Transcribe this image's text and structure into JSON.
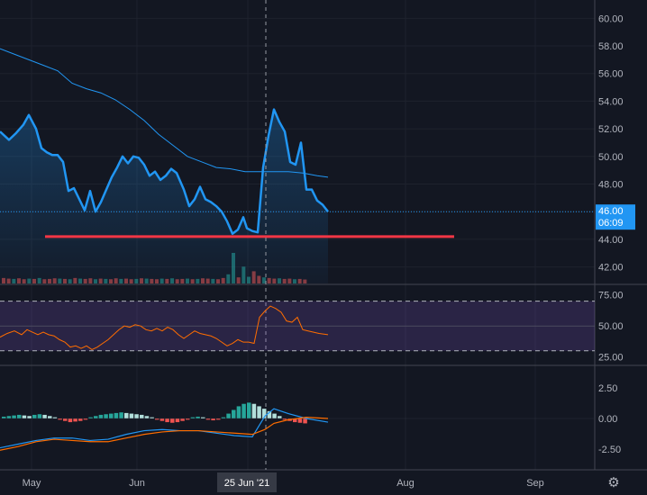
{
  "chart_data": [
    {
      "type": "line",
      "panel": "price",
      "y_axis_ticks": [
        "60.00",
        "58.00",
        "56.00",
        "54.00",
        "52.00",
        "50.00",
        "48.00",
        "46.00",
        "44.00",
        "42.00"
      ],
      "ylim": [
        40.8,
        61
      ],
      "x_ticks": [
        "May",
        "Jun",
        "25 Jun '21",
        "Aug",
        "Sep"
      ],
      "series": [
        {
          "values": [
            [
              0.0,
              51.8
            ],
            [
              0.05,
              51.2
            ],
            [
              0.09,
              51.7
            ],
            [
              0.13,
              52.3
            ],
            [
              0.16,
              53.0
            ],
            [
              0.2,
              52.0
            ],
            [
              0.23,
              50.6
            ],
            [
              0.26,
              50.3
            ],
            [
              0.29,
              50.1
            ],
            [
              0.32,
              50.1
            ],
            [
              0.35,
              49.6
            ],
            [
              0.38,
              47.5
            ],
            [
              0.41,
              47.7
            ],
            [
              0.44,
              46.9
            ],
            [
              0.47,
              46.1
            ],
            [
              0.5,
              47.5
            ],
            [
              0.53,
              46.0
            ],
            [
              0.56,
              46.7
            ],
            [
              0.59,
              47.6
            ],
            [
              0.62,
              48.5
            ],
            [
              0.65,
              49.2
            ],
            [
              0.68,
              50.0
            ],
            [
              0.71,
              49.5
            ],
            [
              0.74,
              50.0
            ],
            [
              0.77,
              49.9
            ],
            [
              0.8,
              49.4
            ],
            [
              0.83,
              48.6
            ],
            [
              0.86,
              48.9
            ],
            [
              0.89,
              48.3
            ],
            [
              0.92,
              48.6
            ],
            [
              0.95,
              49.1
            ],
            [
              0.98,
              48.8
            ],
            [
              1.02,
              47.6
            ],
            [
              1.05,
              46.4
            ],
            [
              1.08,
              46.9
            ],
            [
              1.11,
              47.8
            ],
            [
              1.14,
              46.9
            ],
            [
              1.17,
              46.7
            ],
            [
              1.2,
              46.4
            ],
            [
              1.23,
              46.0
            ],
            [
              1.26,
              45.3
            ],
            [
              1.29,
              44.4
            ],
            [
              1.32,
              44.7
            ],
            [
              1.35,
              45.6
            ],
            [
              1.37,
              44.8
            ],
            [
              1.4,
              44.6
            ],
            [
              1.43,
              44.5
            ],
            [
              1.46,
              49.2
            ],
            [
              1.49,
              51.5
            ],
            [
              1.52,
              53.4
            ],
            [
              1.55,
              52.5
            ],
            [
              1.58,
              51.8
            ],
            [
              1.61,
              49.6
            ],
            [
              1.64,
              49.4
            ],
            [
              1.67,
              51.0
            ],
            [
              1.7,
              47.6
            ],
            [
              1.73,
              47.6
            ],
            [
              1.76,
              46.8
            ],
            [
              1.79,
              46.5
            ],
            [
              1.82,
              46.0
            ]
          ]
        },
        {
          "values": [
            [
              0.0,
              57.8
            ],
            [
              0.08,
              57.4
            ],
            [
              0.16,
              57.0
            ],
            [
              0.24,
              56.6
            ],
            [
              0.32,
              56.2
            ],
            [
              0.4,
              55.3
            ],
            [
              0.48,
              54.9
            ],
            [
              0.56,
              54.6
            ],
            [
              0.64,
              54.1
            ],
            [
              0.72,
              53.4
            ],
            [
              0.8,
              52.6
            ],
            [
              0.88,
              51.6
            ],
            [
              0.96,
              50.8
            ],
            [
              1.04,
              50.0
            ],
            [
              1.12,
              49.6
            ],
            [
              1.2,
              49.2
            ],
            [
              1.28,
              49.1
            ],
            [
              1.36,
              48.9
            ],
            [
              1.44,
              48.9
            ],
            [
              1.52,
              48.9
            ],
            [
              1.6,
              48.9
            ],
            [
              1.68,
              48.8
            ],
            [
              1.76,
              48.6
            ],
            [
              1.82,
              48.5
            ]
          ]
        }
      ],
      "volume": {
        "up": [
          0,
          0,
          1,
          0,
          0,
          1,
          0,
          1,
          0,
          0,
          0,
          1,
          0,
          1,
          0,
          1,
          0,
          0,
          1,
          0,
          1,
          0,
          0,
          1,
          0,
          0,
          1,
          0,
          1,
          0,
          0,
          1,
          0,
          1,
          0,
          0,
          1,
          0,
          1,
          0,
          0,
          1,
          0,
          0,
          1,
          1,
          0,
          1,
          1,
          0,
          0,
          1,
          0,
          0,
          1,
          0,
          0,
          1,
          0,
          0
        ],
        "size": [
          0.18,
          0.16,
          0.15,
          0.17,
          0.14,
          0.16,
          0.15,
          0.18,
          0.14,
          0.15,
          0.17,
          0.16,
          0.15,
          0.14,
          0.18,
          0.16,
          0.15,
          0.17,
          0.14,
          0.16,
          0.15,
          0.14,
          0.17,
          0.15,
          0.16,
          0.14,
          0.15,
          0.17,
          0.16,
          0.15,
          0.14,
          0.16,
          0.15,
          0.17,
          0.14,
          0.15,
          0.16,
          0.14,
          0.15,
          0.17,
          0.16,
          0.15,
          0.14,
          0.18,
          0.3,
          1.0,
          0.2,
          0.55,
          0.22,
          0.4,
          0.25,
          0.2,
          0.18,
          0.16,
          0.17,
          0.15,
          0.16,
          0.14,
          0.15,
          0.13
        ]
      },
      "horizontal_line": {
        "value": 44.2,
        "x_from": 0.25,
        "x_to": 2.52,
        "color": "#f23645"
      },
      "last_price_label": "46.00",
      "countdown_label": "06:09",
      "crosshair_x": 1.47
    },
    {
      "type": "line",
      "panel": "rsi",
      "y_axis_ticks": [
        "75.00",
        "50.00",
        "25.00"
      ],
      "ylim": [
        19,
        82
      ],
      "band": [
        30,
        70
      ],
      "values": [
        [
          0.0,
          41
        ],
        [
          0.04,
          44
        ],
        [
          0.08,
          46
        ],
        [
          0.12,
          43
        ],
        [
          0.15,
          47
        ],
        [
          0.18,
          45
        ],
        [
          0.21,
          43
        ],
        [
          0.24,
          45
        ],
        [
          0.27,
          43
        ],
        [
          0.3,
          42
        ],
        [
          0.33,
          39
        ],
        [
          0.36,
          37
        ],
        [
          0.39,
          33
        ],
        [
          0.42,
          34
        ],
        [
          0.45,
          32
        ],
        [
          0.48,
          34
        ],
        [
          0.51,
          31
        ],
        [
          0.54,
          33
        ],
        [
          0.57,
          36
        ],
        [
          0.6,
          39
        ],
        [
          0.63,
          43
        ],
        [
          0.66,
          47
        ],
        [
          0.69,
          50
        ],
        [
          0.72,
          49
        ],
        [
          0.75,
          51
        ],
        [
          0.78,
          50
        ],
        [
          0.81,
          47
        ],
        [
          0.84,
          46
        ],
        [
          0.87,
          48
        ],
        [
          0.9,
          46
        ],
        [
          0.93,
          49
        ],
        [
          0.96,
          47
        ],
        [
          0.99,
          43
        ],
        [
          1.02,
          40
        ],
        [
          1.05,
          43
        ],
        [
          1.08,
          46
        ],
        [
          1.11,
          44
        ],
        [
          1.14,
          43
        ],
        [
          1.17,
          42
        ],
        [
          1.2,
          40
        ],
        [
          1.23,
          37
        ],
        [
          1.26,
          34
        ],
        [
          1.29,
          36
        ],
        [
          1.32,
          39
        ],
        [
          1.35,
          37
        ],
        [
          1.38,
          37
        ],
        [
          1.41,
          36
        ],
        [
          1.44,
          57
        ],
        [
          1.47,
          62
        ],
        [
          1.5,
          66
        ],
        [
          1.53,
          64
        ],
        [
          1.56,
          61
        ],
        [
          1.59,
          54
        ],
        [
          1.62,
          53
        ],
        [
          1.65,
          57
        ],
        [
          1.68,
          47
        ],
        [
          1.71,
          46
        ],
        [
          1.74,
          45
        ],
        [
          1.77,
          44
        ],
        [
          1.82,
          43
        ]
      ],
      "line_color": "#ff6d00"
    },
    {
      "type": "bar",
      "panel": "macd",
      "y_axis_ticks": [
        "2.50",
        "0.00",
        "-2.50"
      ],
      "ylim": [
        -4.2,
        4.2
      ],
      "histogram": [
        0.15,
        0.2,
        0.25,
        0.3,
        0.25,
        0.2,
        0.3,
        0.35,
        0.3,
        0.2,
        0.1,
        -0.1,
        -0.2,
        -0.3,
        -0.25,
        -0.2,
        -0.1,
        0.1,
        0.2,
        0.3,
        0.35,
        0.4,
        0.45,
        0.5,
        0.45,
        0.4,
        0.35,
        0.3,
        0.2,
        0.1,
        -0.1,
        -0.2,
        -0.3,
        -0.35,
        -0.3,
        -0.2,
        -0.1,
        0.1,
        0.15,
        0.1,
        -0.1,
        -0.15,
        -0.1,
        0.1,
        0.4,
        0.7,
        1.0,
        1.2,
        1.3,
        1.2,
        1.0,
        0.8,
        0.6,
        0.4,
        0.2,
        -0.1,
        -0.2,
        -0.3,
        -0.35,
        -0.4
      ],
      "macd_line": [
        [
          0.0,
          -2.4
        ],
        [
          0.1,
          -2.1
        ],
        [
          0.2,
          -1.8
        ],
        [
          0.3,
          -1.6
        ],
        [
          0.4,
          -1.6
        ],
        [
          0.5,
          -1.8
        ],
        [
          0.6,
          -1.7
        ],
        [
          0.7,
          -1.3
        ],
        [
          0.8,
          -1.0
        ],
        [
          0.9,
          -0.9
        ],
        [
          1.0,
          -1.0
        ],
        [
          1.1,
          -1.0
        ],
        [
          1.2,
          -1.2
        ],
        [
          1.3,
          -1.4
        ],
        [
          1.4,
          -1.5
        ],
        [
          1.47,
          0.2
        ],
        [
          1.52,
          0.8
        ],
        [
          1.6,
          0.4
        ],
        [
          1.7,
          0.0
        ],
        [
          1.82,
          -0.3
        ]
      ],
      "signal_line": [
        [
          0.0,
          -2.6
        ],
        [
          0.1,
          -2.3
        ],
        [
          0.2,
          -1.9
        ],
        [
          0.3,
          -1.7
        ],
        [
          0.4,
          -1.8
        ],
        [
          0.5,
          -1.9
        ],
        [
          0.6,
          -1.9
        ],
        [
          0.7,
          -1.6
        ],
        [
          0.8,
          -1.3
        ],
        [
          0.9,
          -1.1
        ],
        [
          1.0,
          -1.0
        ],
        [
          1.1,
          -1.0
        ],
        [
          1.2,
          -1.1
        ],
        [
          1.3,
          -1.2
        ],
        [
          1.4,
          -1.3
        ],
        [
          1.47,
          -0.9
        ],
        [
          1.52,
          -0.4
        ],
        [
          1.6,
          -0.1
        ],
        [
          1.7,
          0.1
        ],
        [
          1.82,
          0.0
        ]
      ]
    }
  ],
  "colors": {
    "background": "#131722",
    "price_line": "#2196f3",
    "ma_line": "#2196f3",
    "rsi_band": "#7e57c2",
    "vol_up": "#26a69a",
    "vol_down": "#ef5350",
    "hist_up": "#26a69a",
    "hist_down": "#ef5350",
    "hist_up_fading": "#b2dfdb",
    "macd": "#2196f3",
    "signal": "#ff6d00"
  },
  "toolbar": {
    "settings_icon": "gear-icon"
  }
}
